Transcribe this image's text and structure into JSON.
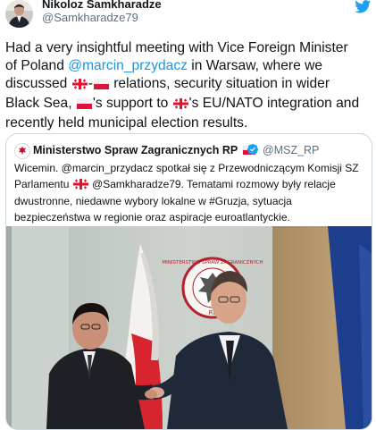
{
  "author": {
    "name": "Nikoloz Samkharadze",
    "handle": "@Samkharadze79"
  },
  "tweet": {
    "lines": [
      [
        {
          "t": "Had a very insightful meeting with Vice Foreign Minister"
        }
      ],
      [
        {
          "t": "of Poland "
        },
        {
          "m": "@marcin_przydacz"
        },
        {
          "t": " in Warsaw, where we"
        }
      ],
      [
        {
          "t": "discussed "
        },
        {
          "f": "ge"
        },
        {
          "t": "-"
        },
        {
          "f": "pl"
        },
        {
          "t": " relations, security situation in wider"
        }
      ],
      [
        {
          "t": "Black Sea, "
        },
        {
          "f": "pl"
        },
        {
          "t": "'s support to "
        },
        {
          "f": "ge"
        },
        {
          "t": "'s EU/NATO integration and"
        }
      ],
      [
        {
          "t": "recently held municipal election results."
        }
      ]
    ]
  },
  "quoted": {
    "name": "Ministerstwo Spraw Zagranicznych RP",
    "handle": "@MSZ_RP",
    "name_flag": "pl",
    "lines": [
      [
        {
          "t": "Wicemin. @marcin_przydacz spotkał się z Przewodniczącym Komisji SZ"
        }
      ],
      [
        {
          "t": "Parlamentu "
        },
        {
          "f": "ge"
        },
        {
          "t": " @Samkharadze79. Tematami rozmowy były relacje"
        }
      ],
      [
        {
          "t": "dwustronne, niedawne wybory lokalne w #Gruzja, sytuacja"
        }
      ],
      [
        {
          "t": "bezpieczeństwa w regionie oraz aspiracje euroatlantyckie."
        }
      ]
    ],
    "photo": {
      "emblem_text": "MINISTERSTWO SPRAW ZAGRANICZNYCH",
      "emblem_sub": "RP"
    }
  },
  "icons": {
    "bird": "twitter-bird-icon",
    "verified": "verified-badge-icon"
  },
  "colors": {
    "link": "#1b95e0",
    "secondary_text": "#5b7083",
    "twitter_blue": "#1da1f2",
    "border": "#ccd6dd"
  }
}
